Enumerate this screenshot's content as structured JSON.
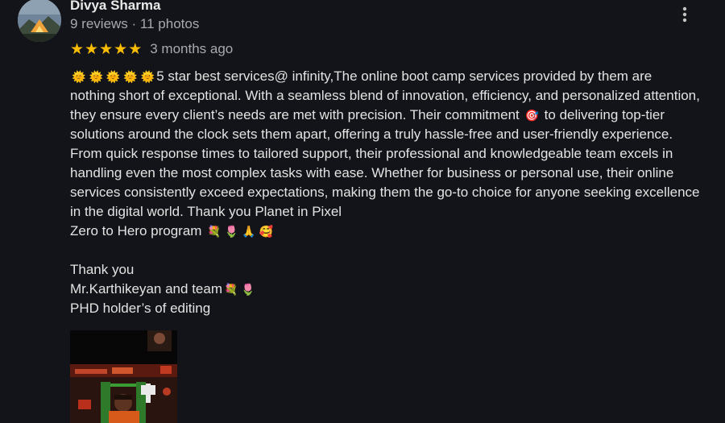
{
  "review": {
    "author": {
      "name": "Divya Sharma",
      "meta": "9 reviews · 11 photos"
    },
    "rating": 5,
    "stars": [
      "★",
      "★",
      "★",
      "★",
      "★"
    ],
    "date": "3 months ago",
    "text_lines": [
      {
        "prefix_icons": [
          "sun-icon",
          "sun-icon",
          "sun-icon",
          "sun-icon",
          "sun-icon"
        ],
        "text": "5 star best services@ infinity,The online boot camp services provided by them are"
      },
      {
        "text": "nothing short of exceptional. With a seamless blend of innovation, efficiency, and personalized attention,"
      },
      {
        "text_before": "they ensure every client’s needs are met with precision. Their commitment ",
        "inline_icon": "target-icon",
        "text_after": " to delivering top-tier"
      },
      {
        "text": "solutions around the clock sets them apart, offering a truly hassle-free and user-friendly experience."
      },
      {
        "text": "From quick response times to tailored support, their professional and knowledgeable team excels in"
      },
      {
        "text": "handling even the most complex tasks with ease. Whether for business or personal use, their online"
      },
      {
        "text": "services consistently exceed expectations, making them the go-to choice for anyone seeking excellence"
      },
      {
        "text": "in the digital world. Thank you Planet in Pixel"
      },
      {
        "text": "Zero to Hero program ",
        "suffix_icons": [
          "bouquet-icon",
          "tulip-icon",
          "praying-hands-icon",
          "smiling-face-hearts-icon"
        ]
      },
      {
        "text": ""
      },
      {
        "text": "Thank you"
      },
      {
        "text": "Mr.Karthikeyan and team",
        "suffix_icons": [
          "bouquet-icon",
          "tulip-icon"
        ]
      },
      {
        "text": "PHD holder’s of editing"
      }
    ],
    "icons": {
      "sun": "🌞",
      "target": "🎯",
      "bouquet": "💐",
      "tulip": "🌷",
      "pray": "🙏",
      "face": "🥰",
      "more": "more-vert-icon"
    },
    "colors": {
      "background": "#131419",
      "star": "#fbbc04",
      "text": "#e3e3e3",
      "meta": "#a7a9ae"
    }
  }
}
